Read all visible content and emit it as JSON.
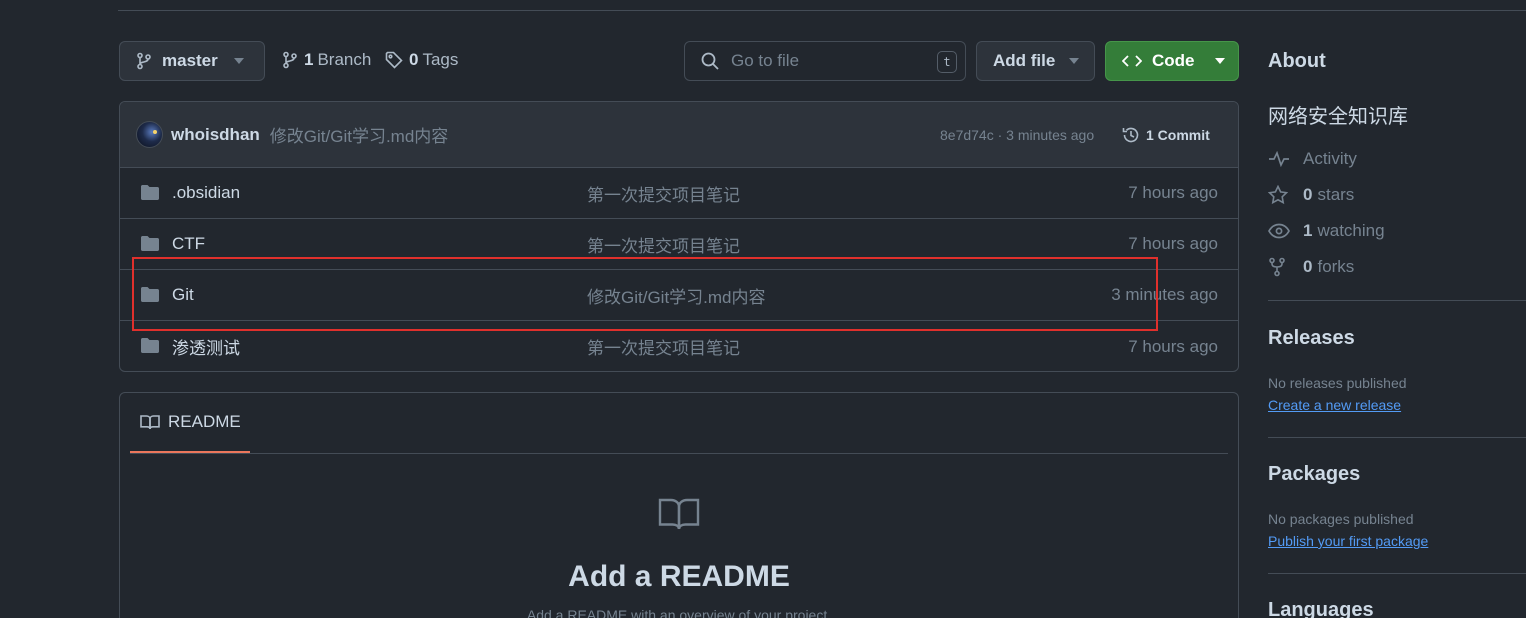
{
  "toolbar": {
    "branch_name": "master",
    "branch_count": "1",
    "branch_label": "Branch",
    "tag_count": "0",
    "tag_label": "Tags",
    "search_placeholder": "Go to file",
    "search_shortcut": "t",
    "add_file_label": "Add file",
    "code_label": "Code"
  },
  "latest_commit": {
    "author": "whoisdhan",
    "message": "修改Git/Git学习.md内容",
    "sha_time": "8e7d74c · 3 minutes ago",
    "commit_count": "1 Commit"
  },
  "files": [
    {
      "name": ".obsidian",
      "message": "第一次提交项目笔记",
      "age": "7 hours ago"
    },
    {
      "name": "CTF",
      "message": "第一次提交项目笔记",
      "age": "7 hours ago"
    },
    {
      "name": "Git",
      "message": "修改Git/Git学习.md内容",
      "age": "3 minutes ago"
    },
    {
      "name": "渗透测试",
      "message": "第一次提交项目笔记",
      "age": "7 hours ago"
    }
  ],
  "readme": {
    "tab_label": "README",
    "title": "Add a README",
    "subtitle": "Add a README with an overview of your project."
  },
  "sidebar": {
    "about_title": "About",
    "description": "网络安全知识库",
    "activity_label": "Activity",
    "stars_count": "0",
    "stars_label": "stars",
    "watching_count": "1",
    "watching_label": "watching",
    "forks_count": "0",
    "forks_label": "forks",
    "releases_title": "Releases",
    "releases_empty": "No releases published",
    "releases_link": "Create a new release",
    "packages_title": "Packages",
    "packages_empty": "No packages published",
    "packages_link": "Publish your first package",
    "languages_title": "Languages"
  },
  "colors": {
    "background": "#22272e",
    "code_button": "#347d39",
    "link": "#539bf5",
    "highlight_box": "#e0302c",
    "readme_tab_underline": "#ec775c"
  }
}
